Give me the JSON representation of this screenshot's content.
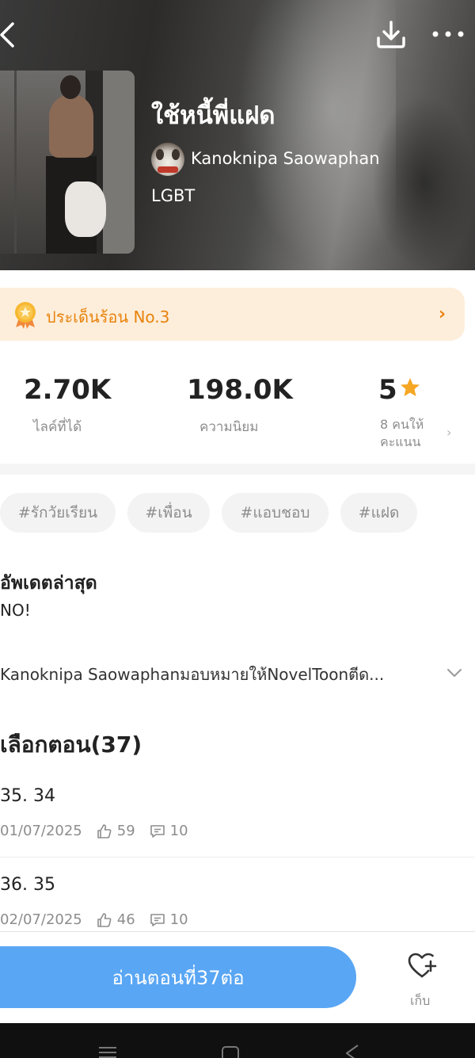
{
  "book": {
    "title": "ใช้หนี้พี่แฝด",
    "author": "Kanoknipa Saowaphan",
    "category": "LGBT"
  },
  "hot_banner": {
    "text": "ประเด็นร้อน No.3",
    "arrow": "›"
  },
  "stats": {
    "likes_value": "2.70K",
    "likes_label": "ไลค์ที่ได้",
    "popularity_value": "198.0K",
    "popularity_label": "ความนิยม",
    "rating_value": "5",
    "rating_sub_1": "8 คนให้",
    "rating_sub_2": "คะแนน",
    "rating_chevron": "›"
  },
  "tags": [
    "#รักวัยเรียน",
    "#เพื่อน",
    "#แอบชอบ",
    "#แฝด"
  ],
  "latest_update": {
    "label": "อัพเดตล่าสุด",
    "text": "NO!"
  },
  "licence_text": "Kanoknipa Saowaphanมอบหมายให้NovelToonตีด...",
  "chapters": {
    "heading": "เลือกตอน(37)",
    "items": [
      {
        "title": "35. 34",
        "date": "01/07/2025",
        "likes": "59",
        "comments": "10"
      },
      {
        "title": "36. 35",
        "date": "02/07/2025",
        "likes": "46",
        "comments": "10"
      }
    ]
  },
  "actions": {
    "read_label": "อ่านตอนที่37ต่อ",
    "save_label": "เก็บ"
  },
  "colors": {
    "accent": "#59a6f4",
    "hot_text": "#e8820c",
    "hot_bg": "#fdeedb",
    "star": "#f5a623"
  },
  "icons": {
    "back": "back-arrow-icon",
    "download": "download-icon",
    "more": "more-dots-icon",
    "medal": "medal-icon",
    "star": "star-icon",
    "like": "thumbs-up-icon",
    "comment": "comment-icon",
    "heart": "heart-add-icon"
  }
}
